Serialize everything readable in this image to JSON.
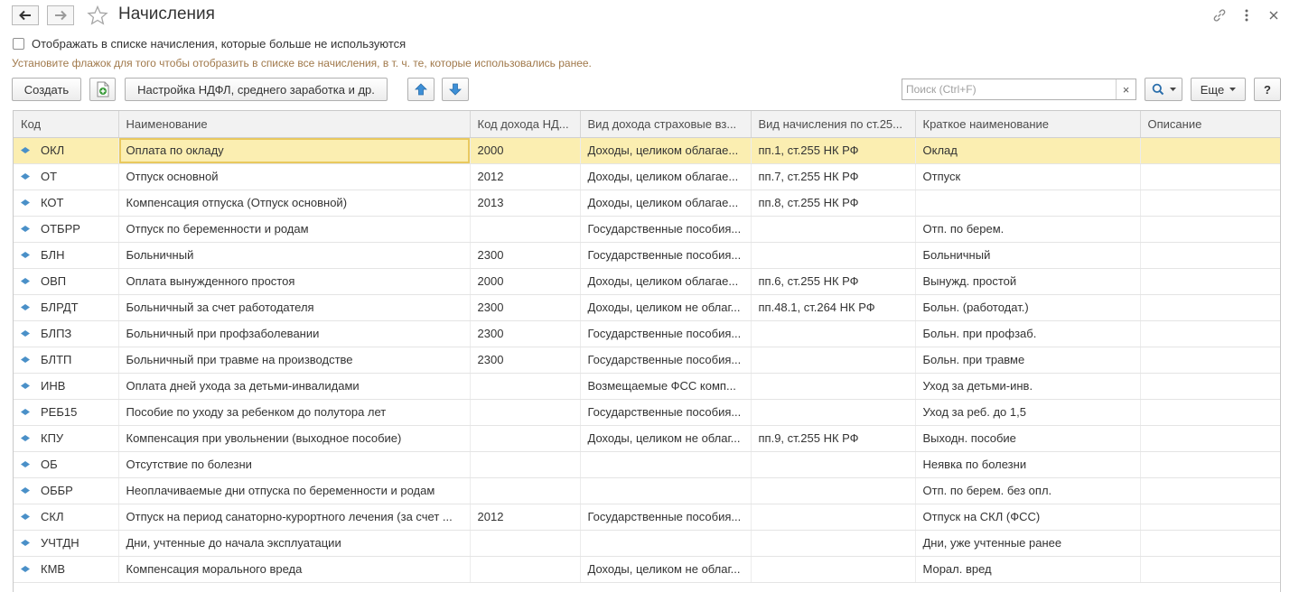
{
  "window": {
    "title": "Начисления"
  },
  "options": {
    "show_unused_label": "Отображать в списке начисления, которые больше не используются",
    "hint": "Установите флажок для того чтобы отобразить в списке все начисления, в т. ч. те, которые использовались ранее."
  },
  "toolbar": {
    "create_label": "Создать",
    "settings_label": "Настройка НДФЛ, среднего заработка и др.",
    "search_placeholder": "Поиск (Ctrl+F)",
    "clear_label": "×",
    "more_label": "Еще",
    "help_label": "?"
  },
  "table": {
    "columns": [
      "Код",
      "Наименование",
      "Код дохода НД...",
      "Вид дохода страховые вз...",
      "Вид начисления по ст.25...",
      "Краткое наименование",
      "Описание"
    ],
    "rows": [
      [
        "ОКЛ",
        "Оплата по окладу",
        "2000",
        "Доходы, целиком облагае...",
        "пп.1, ст.255 НК РФ",
        "Оклад",
        ""
      ],
      [
        "ОТ",
        "Отпуск основной",
        "2012",
        "Доходы, целиком облагае...",
        "пп.7, ст.255 НК РФ",
        "Отпуск",
        ""
      ],
      [
        "КОТ",
        "Компенсация отпуска (Отпуск основной)",
        "2013",
        "Доходы, целиком облагае...",
        "пп.8, ст.255 НК РФ",
        "",
        ""
      ],
      [
        "ОТБРР",
        "Отпуск по беременности и родам",
        "",
        "Государственные пособия...",
        "",
        "Отп. по берем.",
        ""
      ],
      [
        "БЛН",
        "Больничный",
        "2300",
        "Государственные пособия...",
        "",
        "Больничный",
        ""
      ],
      [
        "ОВП",
        "Оплата вынужденного простоя",
        "2000",
        "Доходы, целиком облагае...",
        "пп.6, ст.255 НК РФ",
        "Вынужд. простой",
        ""
      ],
      [
        "БЛРДТ",
        "Больничный за счет работодателя",
        "2300",
        "Доходы, целиком не облаг...",
        "пп.48.1, ст.264 НК РФ",
        "Больн. (работодат.)",
        ""
      ],
      [
        "БЛПЗ",
        "Больничный при профзаболевании",
        "2300",
        "Государственные пособия...",
        "",
        "Больн. при профзаб.",
        ""
      ],
      [
        "БЛТП",
        "Больничный при травме на производстве",
        "2300",
        "Государственные пособия...",
        "",
        "Больн. при травме",
        ""
      ],
      [
        "ИНВ",
        "Оплата дней ухода за детьми-инвалидами",
        "",
        "Возмещаемые ФСС комп...",
        "",
        "Уход за детьми-инв.",
        ""
      ],
      [
        "РЕБ15",
        "Пособие по уходу за ребенком до полутора лет",
        "",
        "Государственные пособия...",
        "",
        "Уход за реб. до 1,5",
        ""
      ],
      [
        "КПУ",
        "Компенсация при увольнении (выходное пособие)",
        "",
        "Доходы, целиком не облаг...",
        "пп.9, ст.255 НК РФ",
        "Выходн. пособие",
        ""
      ],
      [
        "ОБ",
        "Отсутствие по болезни",
        "",
        "",
        "",
        "Неявка по болезни",
        ""
      ],
      [
        "ОББР",
        "Неоплачиваемые дни отпуска по беременности и родам",
        "",
        "",
        "",
        "Отп. по берем. без опл.",
        ""
      ],
      [
        "СКЛ",
        "Отпуск на период санаторно-курортного лечения (за счет ...",
        "2012",
        "Государственные пособия...",
        "",
        "Отпуск на СКЛ (ФСС)",
        ""
      ],
      [
        "УЧТДН",
        "Дни, учтенные до начала эксплуатации",
        "",
        "",
        "",
        "Дни, уже учтенные ранее",
        ""
      ],
      [
        "КМВ",
        "Компенсация морального вреда",
        "",
        "Доходы, целиком не облаг...",
        "",
        "Морал. вред",
        ""
      ]
    ]
  },
  "icons": [
    "back-arrow-icon",
    "forward-arrow-icon",
    "favorite-star-icon",
    "link-icon",
    "more-vertical-icon",
    "close-icon",
    "add-copy-icon",
    "move-up-icon",
    "move-down-icon",
    "search-icon",
    "row-marker-icon"
  ],
  "colors": {
    "selected_row": "#fbeeb1",
    "hint_text": "#a0784a",
    "row_marker": "#4a90c8"
  }
}
